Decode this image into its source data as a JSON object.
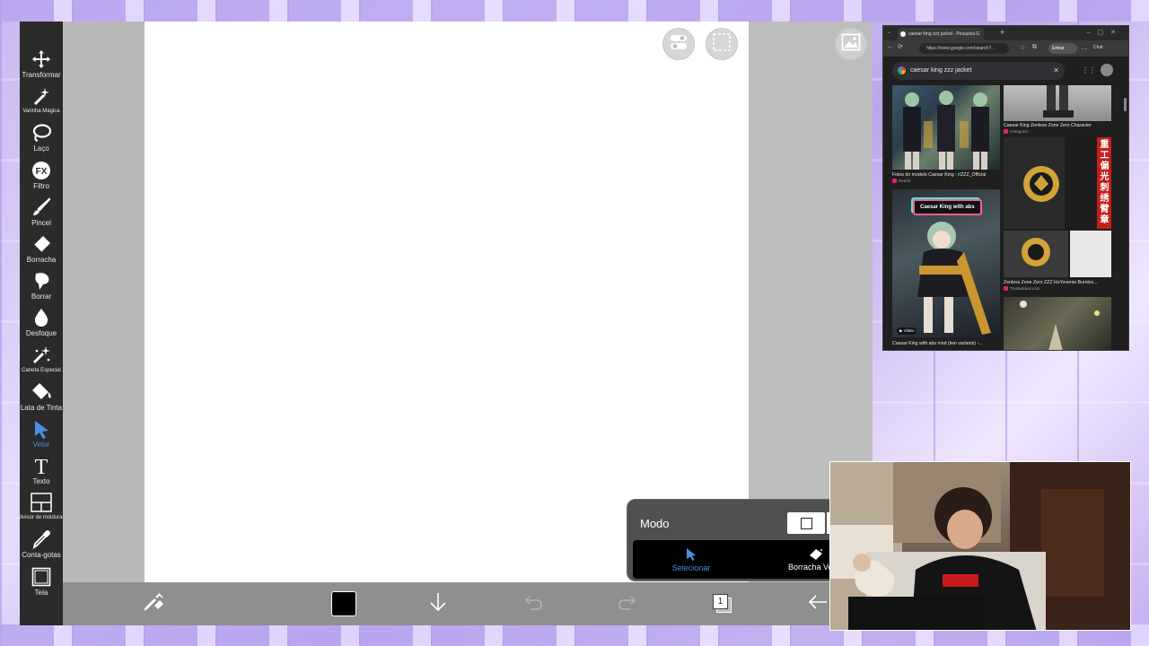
{
  "app": {
    "tools": [
      {
        "label": "Transformar",
        "icon": "move-arrows-icon"
      },
      {
        "label": "Varinha Mágica",
        "icon": "magic-wand-icon"
      },
      {
        "label": "Laço",
        "icon": "lasso-icon"
      },
      {
        "label": "Filtro",
        "icon": "fx-filter-icon"
      },
      {
        "label": "Pincel",
        "icon": "brush-icon"
      },
      {
        "label": "Borracha",
        "icon": "eraser-icon"
      },
      {
        "label": "Borrar",
        "icon": "smudge-icon"
      },
      {
        "label": "Desfoque",
        "icon": "blur-drop-icon"
      },
      {
        "label": "Caneta Especial",
        "icon": "special-pen-icon"
      },
      {
        "label": "Lata de Tinta",
        "icon": "paint-bucket-icon"
      },
      {
        "label": "Vetor",
        "icon": "vector-cursor-icon",
        "active": true
      },
      {
        "label": "Texto",
        "icon": "text-t-icon"
      },
      {
        "label": "Divisor de molduras",
        "icon": "frame-divider-icon"
      },
      {
        "label": "Conta-gotas",
        "icon": "eyedropper-icon"
      },
      {
        "label": "Tela",
        "icon": "canvas-square-icon"
      }
    ],
    "mode": {
      "title": "Modo",
      "options": [
        {
          "label": "Selecionar",
          "active": true
        },
        {
          "label": "Borracha Vetor"
        }
      ]
    },
    "bottom": {
      "current_color": "#000000",
      "layer_number": "1"
    },
    "accent": "#4a90e2"
  },
  "browser": {
    "tab_title": "caesar king zzz jacket - Pesquisa G",
    "url": "https://www.google.com/search?...",
    "entrar_label": "Entrar",
    "chat_label": "Chat",
    "search_query": "caesar king zzz jacket",
    "results": [
      {
        "caption": "Fotos do modelo Caesar King : r/ZZZ_Official",
        "source": "Reddit"
      },
      {
        "caption": "Caesar King Zenless Zone Zero Character",
        "source": "Instagram"
      },
      {
        "caption": "Zenless Zone Zero ZZZ HoYoverse Burnice...",
        "source": "Trusteddeal.com"
      },
      {
        "caption": "Caesar King with abs mod (two variants) -...",
        "source": ""
      }
    ],
    "badge_text": "Caesar King with abs",
    "video_label": "▶ Vídeo",
    "cjk_text": "重工偏光刺绣臂章"
  }
}
